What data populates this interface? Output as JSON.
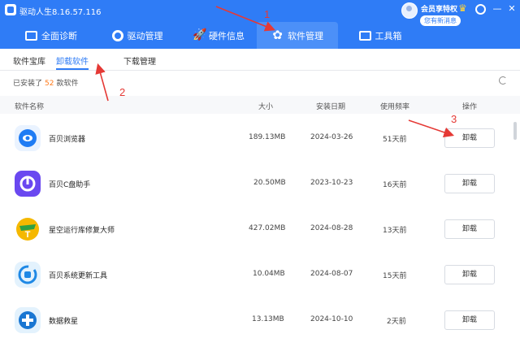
{
  "window": {
    "title": "驱动人生8.16.57.116",
    "vip_label": "会员享特权",
    "message_badge": "您有新消息",
    "minimize_symbol": "—",
    "close_symbol": "✕"
  },
  "nav": {
    "tabs": [
      {
        "label": "全面诊断",
        "icon": "monitor-icon"
      },
      {
        "label": "驱动管理",
        "icon": "gear-icon"
      },
      {
        "label": "硬件信息",
        "icon": "rocket-icon"
      },
      {
        "label": "软件管理",
        "icon": "flower-icon",
        "active": true
      },
      {
        "label": "工具箱",
        "icon": "toolbox-icon"
      }
    ]
  },
  "subtabs": [
    {
      "label": "软件宝库"
    },
    {
      "label": "卸载软件",
      "active": true
    },
    {
      "label": "下载管理"
    }
  ],
  "summary": {
    "prefix": "已安装了",
    "count": "52",
    "suffix": "款软件"
  },
  "table": {
    "headers": {
      "name": "软件名称",
      "size": "大小",
      "date": "安装日期",
      "freq": "使用频率",
      "action": "操作"
    },
    "rows": [
      {
        "name": "百贝浏览器",
        "size": "189.13MB",
        "date": "2024-03-26",
        "freq": "51天前",
        "action": "卸载",
        "icon": "browser-icon",
        "color": "#1f7cf4"
      },
      {
        "name": "百贝C盘助手",
        "size": "20.50MB",
        "date": "2023-10-23",
        "freq": "16天前",
        "action": "卸载",
        "icon": "disk-cleaner-icon",
        "color": "#6a48f0"
      },
      {
        "name": "星空运行库修复大师",
        "size": "427.02MB",
        "date": "2024-08-28",
        "freq": "13天前",
        "action": "卸载",
        "icon": "runtime-repair-icon",
        "color": "#f5b800"
      },
      {
        "name": "百贝系统更新工具",
        "size": "10.04MB",
        "date": "2024-08-07",
        "freq": "15天前",
        "action": "卸载",
        "icon": "system-update-icon",
        "color": "#1e88e5"
      },
      {
        "name": "数据救星",
        "size": "13.13MB",
        "date": "2024-10-10",
        "freq": "2天前",
        "action": "卸载",
        "icon": "data-rescue-icon",
        "color": "#1976d2"
      }
    ]
  },
  "annotations": [
    "1",
    "2",
    "3"
  ],
  "colors": {
    "accent": "#2f7cf6",
    "annotation": "#e53935",
    "count_highlight": "#ff7a1a"
  }
}
